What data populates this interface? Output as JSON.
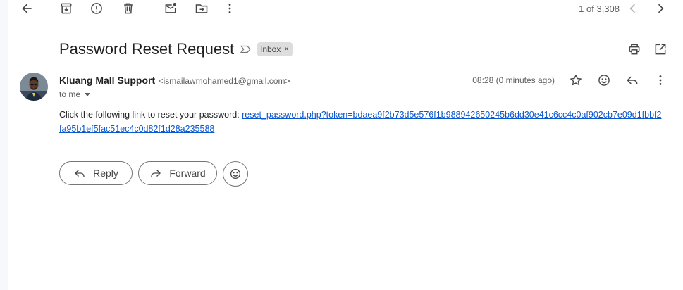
{
  "toolbar": {
    "counter": "1 of 3,308"
  },
  "message": {
    "subject": "Password Reset Request",
    "label": "Inbox",
    "label_remove": "×",
    "sender_name": "Kluang Mall Support",
    "sender_email": "<ismailawmohamed1@gmail.com>",
    "recipient": "to me",
    "time": "08:28 (0 minutes ago)",
    "body_text": "Click the following link to reset your password: ",
    "link": "reset_password.php?token=bdaea9f2b73d5e576f1b988942650245b6dd30e41c6cc4c0af902cb7e09d1fbbf2fa95b1ef5fac51ec4c0d82f1d28a235588"
  },
  "actions": {
    "reply": "Reply",
    "forward": "Forward"
  },
  "colors": {
    "link": "#0b57d0",
    "label_bg": "#dddddd"
  }
}
